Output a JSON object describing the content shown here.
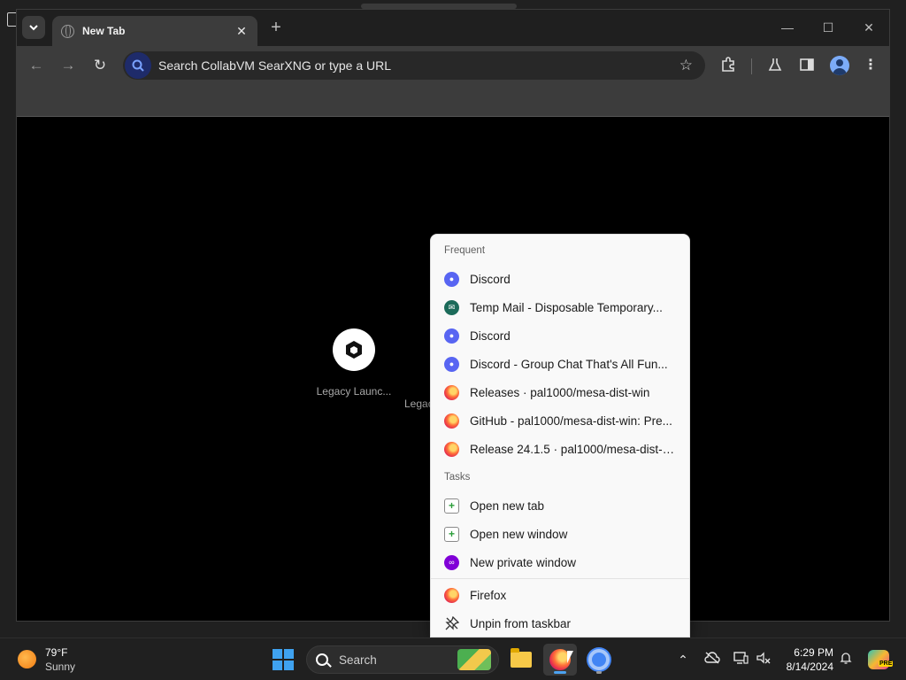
{
  "browser": {
    "tab_title": "New Tab",
    "tab_close_glyph": "✕",
    "new_tab_glyph": "+",
    "window_controls": {
      "minimize": "—",
      "maximize": "☐",
      "close": "✕"
    },
    "nav": {
      "back": "←",
      "forward": "→",
      "reload": "↻"
    },
    "omnibox_text": "Search CollabVM SearXNG or type a URL",
    "shortcuts": [
      {
        "label": "Legacy Launc..."
      },
      {
        "label": "Legacy Launcher"
      }
    ]
  },
  "jump_list": {
    "frequent_heading": "Frequent",
    "frequent": [
      {
        "label": "Discord",
        "icon": "discord-icon"
      },
      {
        "label": "Temp Mail - Disposable Temporary...",
        "icon": "temp-mail-icon"
      },
      {
        "label": "Discord",
        "icon": "discord-icon"
      },
      {
        "label": "Discord - Group Chat That's All Fun...",
        "icon": "discord-icon"
      },
      {
        "label": "Releases · pal1000/mesa-dist-win",
        "icon": "firefox-icon"
      },
      {
        "label": "GitHub - pal1000/mesa-dist-win: Pre...",
        "icon": "firefox-icon"
      },
      {
        "label": "Release 24.1.5 · pal1000/mesa-dist-w...",
        "icon": "firefox-icon"
      }
    ],
    "tasks_heading": "Tasks",
    "tasks": [
      {
        "label": "Open new tab",
        "icon": "new-tab-icon"
      },
      {
        "label": "Open new window",
        "icon": "new-window-icon"
      },
      {
        "label": "New private window",
        "icon": "private-window-icon"
      }
    ],
    "app": {
      "label": "Firefox",
      "icon": "firefox-icon"
    },
    "unpin": {
      "label": "Unpin from taskbar",
      "icon": "unpin-icon"
    }
  },
  "taskbar": {
    "weather_temp": "79°F",
    "weather_cond": "Sunny",
    "search_placeholder": "Search",
    "clock_time": "6:29 PM",
    "clock_date": "8/14/2024",
    "tray_chevron": "⌃",
    "copilot_badge": "PRE"
  },
  "colors": {
    "discord": "#5865f2",
    "firefox": "#ff7139",
    "private": "#8000d7",
    "windows_accent": "#3fa2f0"
  }
}
